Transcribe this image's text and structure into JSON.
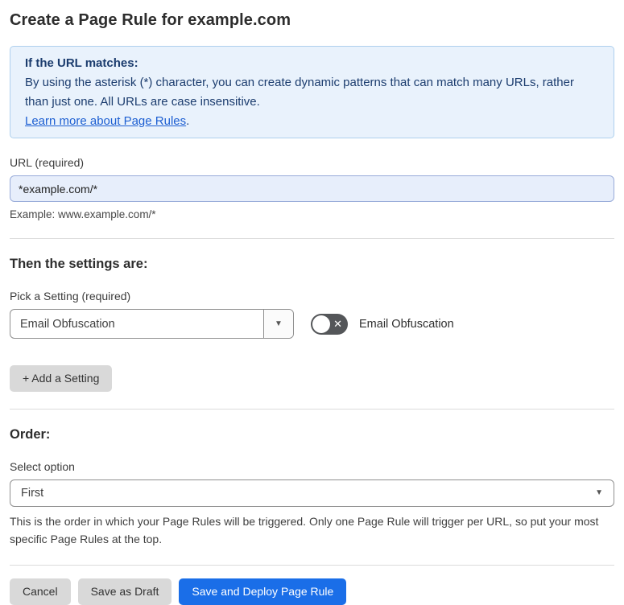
{
  "page": {
    "title": "Create a Page Rule for example.com"
  },
  "info_box": {
    "heading": "If the URL matches:",
    "body": "By using the asterisk (*) character, you can create dynamic patterns that can match many URLs, rather than just one. All URLs are case insensitive.",
    "link_label": "Learn more about Page Rules",
    "link_suffix": "."
  },
  "url_field": {
    "label": "URL (required)",
    "value": "*example.com/*",
    "helper": "Example: www.example.com/*"
  },
  "settings_section": {
    "heading": "Then the settings are:",
    "picker_label": "Pick a Setting (required)",
    "picker_value": "Email Obfuscation",
    "toggle_state": "off",
    "toggle_label": "Email Obfuscation",
    "add_button_label": "+ Add a Setting"
  },
  "order_section": {
    "heading": "Order:",
    "select_label": "Select option",
    "select_value": "First",
    "helper": "This is the order in which your Page Rules will be triggered. Only one Page Rule will trigger per URL, so put your most specific Page Rules at the top."
  },
  "footer": {
    "cancel_label": "Cancel",
    "save_draft_label": "Save as Draft",
    "save_deploy_label": "Save and Deploy Page Rule"
  },
  "icons": {
    "select_arrow": "▼",
    "toggle_x": "✕"
  },
  "colors": {
    "accent_blue": "#1a6ee8",
    "info_bg": "#e9f2fc",
    "info_border": "#aed0ee",
    "info_text": "#1b3c6e",
    "link_blue": "#1d5fd2",
    "input_bg": "#e7eefb",
    "input_border": "#98abd9",
    "button_gray": "#d9d9d9",
    "toggle_off_gray": "#545659"
  }
}
